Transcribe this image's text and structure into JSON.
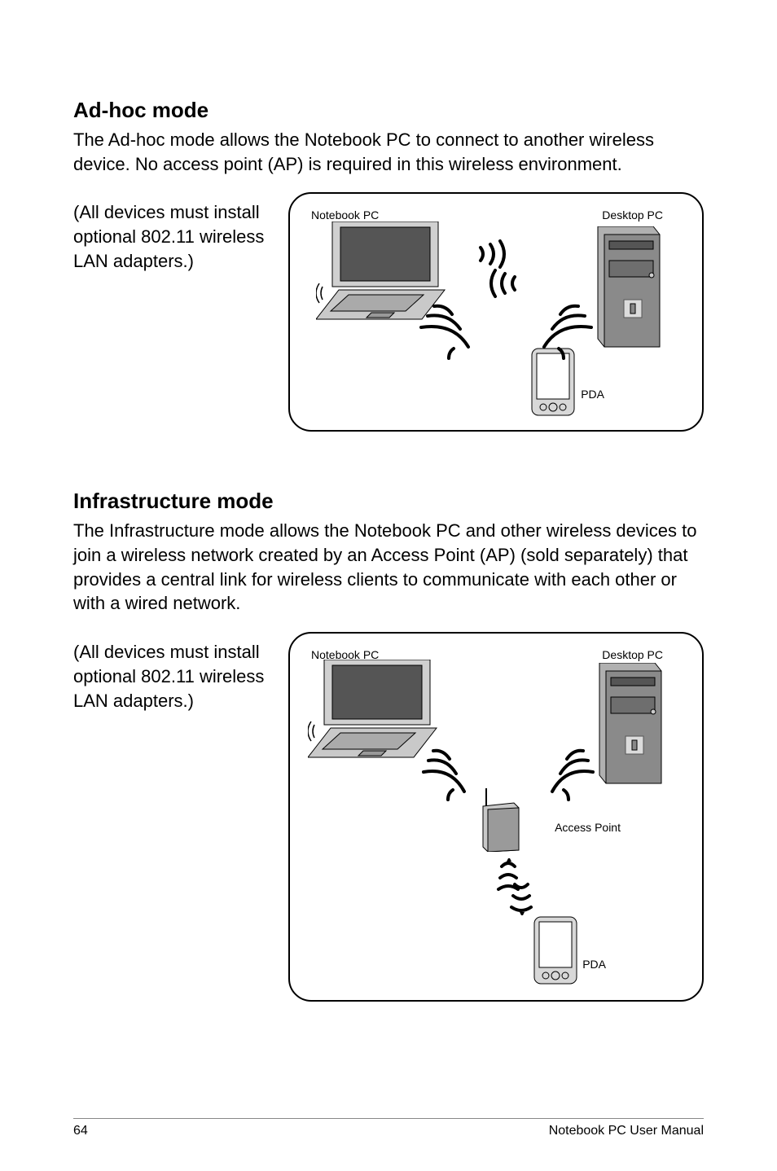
{
  "section1": {
    "title": "Ad-hoc mode",
    "paragraph": "The Ad-hoc mode allows the Notebook PC to connect to another wireless device. No access point (AP) is required in this wireless environment.",
    "side": "(All devices must install optional 802.11 wireless LAN adapters.)",
    "labels": {
      "notebook": "Notebook PC",
      "desktop": "Desktop PC",
      "pda": "PDA"
    }
  },
  "section2": {
    "title": "Infrastructure mode",
    "paragraph": "The Infrastructure mode allows the Notebook PC and other wireless devices to join a wireless network created by an Access Point (AP) (sold separately) that provides a central link for wireless clients to communicate with each other or with a wired network.",
    "side": "(All devices must install optional 802.11 wireless LAN adapters.)",
    "labels": {
      "notebook": "Notebook PC",
      "desktop": "Desktop PC",
      "ap": "Access Point",
      "pda": "PDA"
    }
  },
  "footer": {
    "page": "64",
    "manual": "Notebook PC User Manual"
  }
}
